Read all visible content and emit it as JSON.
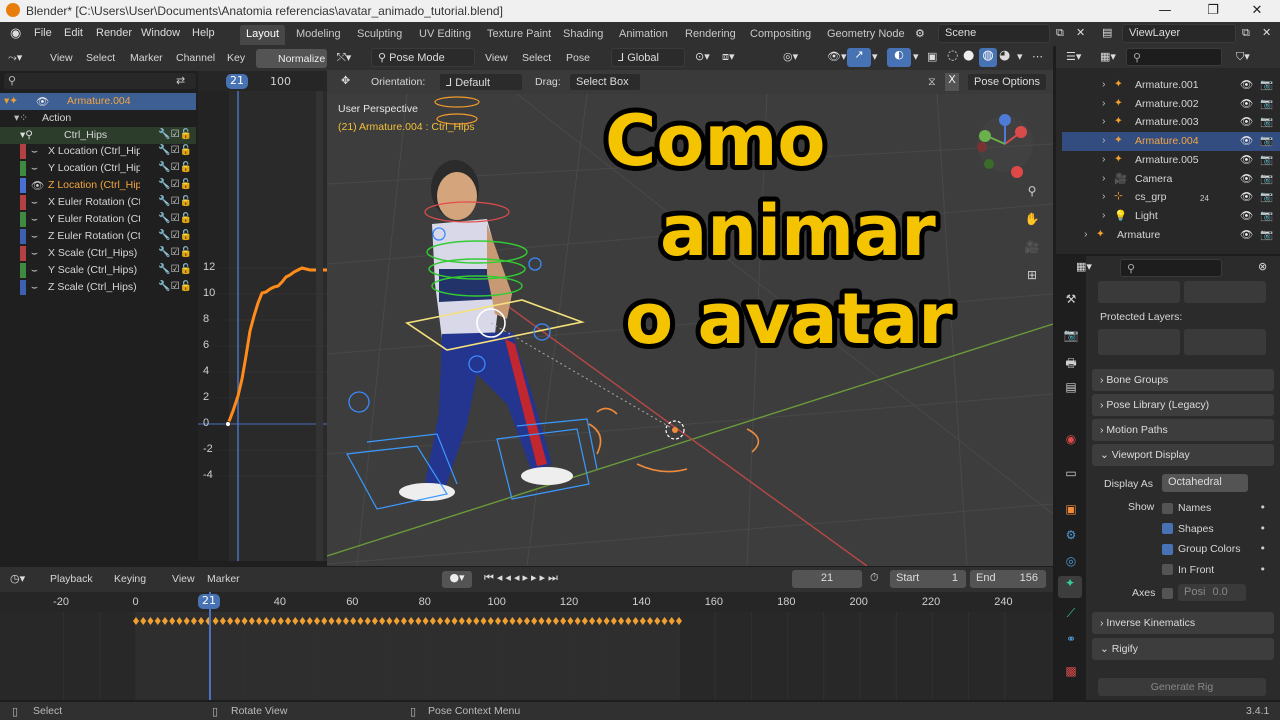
{
  "window": {
    "title": "Blender* [C:\\Users\\User\\Documents\\Anatomia referencias\\avatar_animado_tutorial.blend]"
  },
  "menu": [
    "File",
    "Edit",
    "Render",
    "Window",
    "Help"
  ],
  "workspaces": [
    "Layout",
    "Modeling",
    "Sculpting",
    "UV Editing",
    "Texture Paint",
    "Shading",
    "Animation",
    "Rendering",
    "Compositing",
    "Geometry Node"
  ],
  "scene": "Scene",
  "view_layer": "ViewLayer",
  "graph_editor": {
    "menus": [
      "View",
      "Select",
      "Marker",
      "Channel",
      "Key"
    ],
    "normalize": "Normalize",
    "frame_current": "21",
    "frame_ruler_100": "100",
    "channels": [
      {
        "name": "Armature.004",
        "selected": true
      },
      {
        "name": "Action"
      },
      {
        "name": "Ctrl_Hips"
      },
      {
        "name": "X Location (Ctrl_Hip",
        "color": "#b34141"
      },
      {
        "name": "Y Location (Ctrl_Hip",
        "color": "#3f8a3f"
      },
      {
        "name": "Z Location (Ctrl_Hip",
        "color": "#4a6fd4",
        "active": true
      },
      {
        "name": "X Euler Rotation (Ct",
        "color": "#b34141"
      },
      {
        "name": "Y Euler Rotation (Ct",
        "color": "#3f8a3f"
      },
      {
        "name": "Z Euler Rotation (Ct",
        "color": "#3f5fb3"
      },
      {
        "name": "X Scale (Ctrl_Hips)",
        "color": "#b34141"
      },
      {
        "name": "Y Scale (Ctrl_Hips)",
        "color": "#3f8a3f"
      },
      {
        "name": "Z Scale (Ctrl_Hips)",
        "color": "#3f5fb3"
      }
    ],
    "y_ticks": [
      "12",
      "10",
      "8",
      "6",
      "4",
      "2",
      "0",
      "-2",
      "-4"
    ]
  },
  "viewport": {
    "mode": "Pose Mode",
    "menus": [
      "View",
      "Select",
      "Pose"
    ],
    "transform_orientation": "Global",
    "orientation_label": "Orientation:",
    "orientation_value": "Default",
    "drag_label": "Drag:",
    "drag_value": "Select Box",
    "pose_options": "Pose Options",
    "overlay_title": "User Perspective",
    "overlay_subtitle": "(21) Armature.004 : Ctrl_Hips",
    "caption": [
      "Como",
      "animar",
      "o avatar"
    ]
  },
  "outliner": {
    "rows": [
      {
        "name": "Armature.001"
      },
      {
        "name": "Armature.002"
      },
      {
        "name": "Armature.003"
      },
      {
        "name": "Armature.004",
        "active": true
      },
      {
        "name": "Armature.005"
      },
      {
        "name": "Camera"
      },
      {
        "name": "cs_grp",
        "badge": "24"
      },
      {
        "name": "Light"
      },
      {
        "name": "Armature"
      }
    ]
  },
  "properties": {
    "protected_layers": "Protected Layers:",
    "sections": [
      "Bone Groups",
      "Pose Library (Legacy)",
      "Motion Paths",
      "Viewport Display"
    ],
    "display_as_label": "Display As",
    "display_as_value": "Octahedral",
    "show_label": "Show",
    "show_options": [
      {
        "label": "Names",
        "checked": false
      },
      {
        "label": "Shapes",
        "checked": true
      },
      {
        "label": "Group Colors",
        "checked": true
      },
      {
        "label": "In Front",
        "checked": false
      }
    ],
    "axes_label": "Axes",
    "axes_value": "Posi",
    "axes_num": "0.0",
    "sections2": [
      "Inverse Kinematics",
      "Rigify"
    ],
    "generate_rig": "Generate Rig"
  },
  "timeline": {
    "menus": [
      "Playback",
      "Keying",
      "View",
      "Marker"
    ],
    "current": "21",
    "start_label": "Start",
    "start": "1",
    "end_label": "End",
    "end": "156",
    "ticks": [
      "-20",
      "0",
      "21",
      "40",
      "60",
      "80",
      "100",
      "120",
      "140",
      "160",
      "180",
      "200",
      "220",
      "240"
    ]
  },
  "statusbar": {
    "select": "Select",
    "rotate": "Rotate View",
    "context": "Pose Context Menu",
    "version": "3.4.1"
  },
  "colors": {
    "accent": "#4772b3",
    "caption_fill": "#f5c400",
    "keyframe": "#f0a030",
    "curve": "#ff8c00"
  }
}
